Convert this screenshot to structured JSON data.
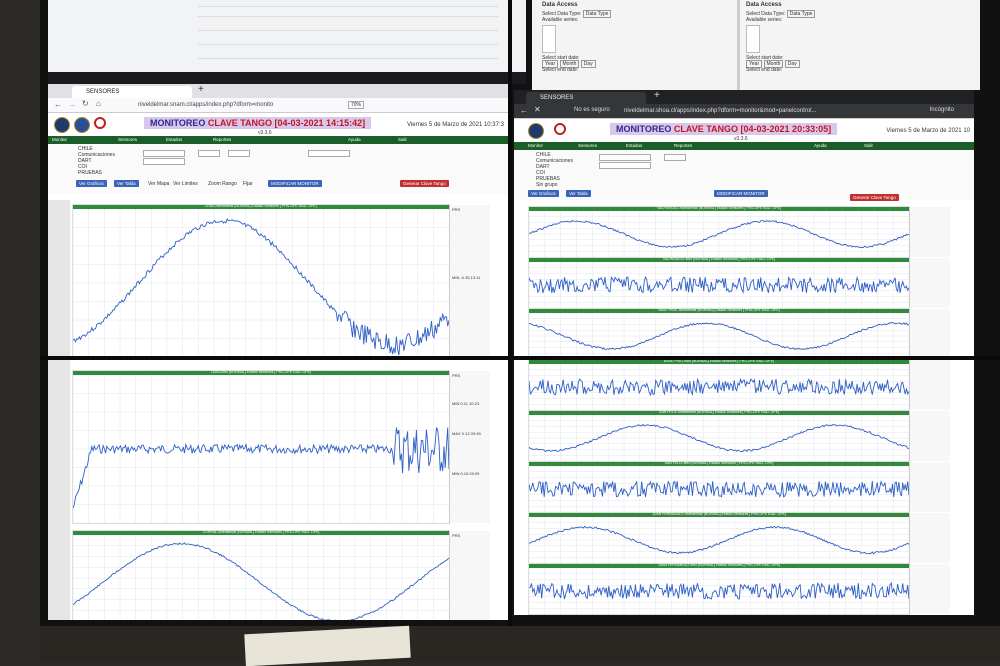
{
  "top_right": {
    "panels": [
      {
        "heading": "Data Access",
        "select_label": "Select Data Type:",
        "select_value": "Data Type",
        "series_label": "Available series:",
        "start_label": "Select start date:",
        "end_label": "Select end date:",
        "year": "Year",
        "month": "Month",
        "day": "Day"
      },
      {
        "heading": "Data Access",
        "select_label": "Select Data Type:",
        "select_value": "Data Type",
        "series_label": "Available series:",
        "start_label": "Select start date:",
        "end_label": "Select end date:",
        "year": "Year",
        "month": "Month",
        "day": "Day"
      }
    ]
  },
  "left_browser": {
    "tab_title": "SENSORES",
    "url": "niveldelmar.snam.cl/apps/index.php?dform=monito",
    "zoom": "70%",
    "monitor_prefix": "MONITOREO",
    "monitor_clave": "CLAVE TANGO [04-03-2021 14:15:42]",
    "version": "v3.3.6",
    "date": "Viernes 5 de Marzo de 2021 10:37:3",
    "nav": [
      "Monitor",
      "Sensores",
      "Estados",
      "Reportes",
      "Ayuda",
      "Salir"
    ],
    "groups": [
      "CHILE",
      "Comunicaciones",
      "DART",
      "COI",
      "PRUEBAS"
    ],
    "btn_graficos": "Ver Graficos",
    "btn_tabla": "Ver Tabla",
    "btn_monitor": "MODIFICAR MONITOR",
    "btn_generar": "Generar Clave Tango",
    "checks": [
      "Ver Mapa",
      "Ver Limites",
      "Zoom Rango",
      "Fijar"
    ]
  },
  "right_browser": {
    "tab_title": "SENSORES",
    "insecure": "No es seguro",
    "url": "niveldelmar.shoa.cl/apps/index.php?dform=monitor&mod=panelcontrol...",
    "incognito": "Incógnito",
    "monitor_prefix": "MONITOREO",
    "monitor_clave": "CLAVE TANGO [04-03-2021 20:33:05]",
    "version": "v3.3.6",
    "date": "Viernes 5 de Marzo de 2021 10",
    "nav": [
      "Monitor",
      "Sensores",
      "Estados",
      "Reportes",
      "Ayuda",
      "Salir"
    ],
    "groups": [
      "CHILE",
      "Comunicaciones",
      "DART",
      "COI",
      "PRUEBAS",
      "Sin grupo"
    ],
    "btn_graficos": "Ver Graficos",
    "btn_tabla": "Ver Tabla",
    "btn_monitor": "MODIFICAR MONITOR",
    "btn_generar": "Generar Clave Tango"
  },
  "left_charts": [
    {
      "title": "LEBU-niveldelmar [NORMAL] Estado Sensores [ PRS-OPE RAD- OPE]",
      "legend": [
        "PRS",
        "MIN -0.35 13:11"
      ]
    },
    {
      "title": "LEBU-filtro [NORMAL] Estado Sensores [ PRS-OPE RAD- OPE]",
      "legend": [
        "PRS",
        "MIN 0.11 10:23",
        "MAX 0.12 09:39",
        "MIN 0.15 09:29"
      ]
    },
    {
      "title": "CORRAL-niveldelmar [NORMAL] Estado Sensores [ PRS-OPE RAD- OPE]",
      "legend": [
        "PRS"
      ]
    }
  ],
  "right_charts": [
    {
      "title": "VALPARAISO-niveldelmar [NORMAL] Estado Sensores [ PRS-OPE RAD- OPE]"
    },
    {
      "title": "VALPARAISO-filtro [NORMAL] Estado Sensores [ PRS-OPE RAD- OPE]"
    },
    {
      "title": "BASE PRAT-niveldelmar [NORMAL] Estado Sensores [ PRS-OPE RAD- OPE]"
    },
    {
      "title": "BASE PRAT-filtro [NORMAL] Estado Sensores [ PRS-OPE RAD- OPE]"
    },
    {
      "title": "SAN FELIX-niveldelmar [NORMAL] Estado Sensores [ PRS-OPE RAD- OPE]"
    },
    {
      "title": "SAN FELIX-filtro [NORMAL] Estado Sensores [ PRS-OPE RAD- OPE]"
    },
    {
      "title": "JUAN FERNANDEZ-niveldelmar [NORMAL] Estado Sensores [ PRS-OPE RAD- OPE]"
    },
    {
      "title": "JUAN FERNANDEZ-filtro [NORMAL] Estado Sensores [ PRS-OPE RAD- OPE]"
    }
  ],
  "colors": {
    "trace": "#2f5fc7",
    "nav": "#1b5e2a",
    "title_bg": "#d9c7ee",
    "clave": "#c01818"
  }
}
